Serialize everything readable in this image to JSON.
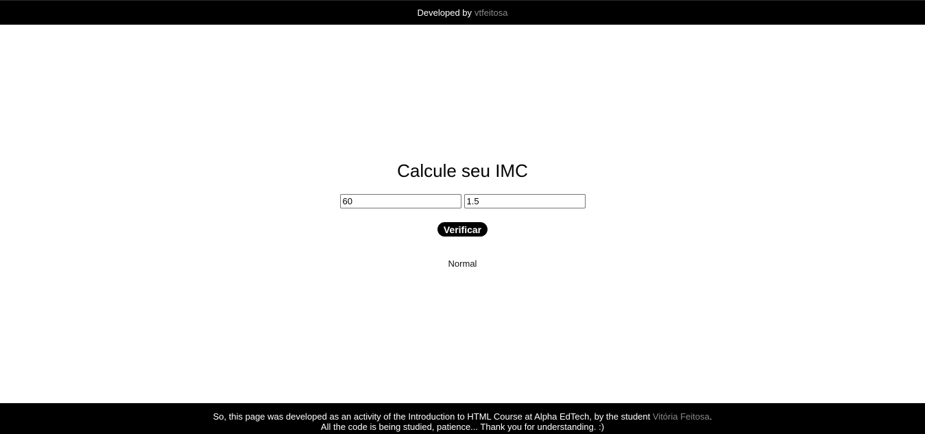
{
  "header": {
    "prefix": "Developed by",
    "author_link": "vtfeitosa"
  },
  "main": {
    "title": "Calcule seu IMC",
    "weight_input": {
      "value": "60"
    },
    "height_input": {
      "value": "1.5"
    },
    "verify_button": "Verificar",
    "result": "Normal"
  },
  "footer": {
    "line1_before": "So, this page was developed as an activity of the Introduction to HTML Course at Alpha EdTech, by the student ",
    "student_link": "Vitória Feitosa",
    "line1_after": ".",
    "line2": "All the code is being studied, patience... Thank you for understanding. :)"
  },
  "colors": {
    "bar_background": "#000000",
    "link_muted": "#8a8a8a",
    "page_background": "#ffffff"
  }
}
